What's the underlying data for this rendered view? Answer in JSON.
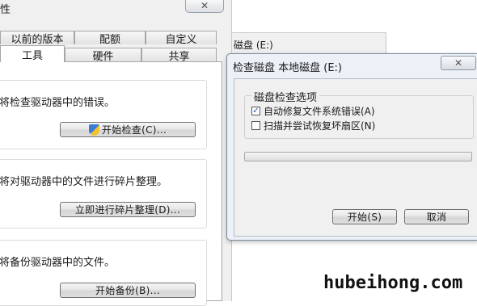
{
  "properties_dialog": {
    "title_fragment": "性",
    "close_glyph": "✕",
    "tabs_back_row": [
      "以前的版本",
      "配额",
      "自定义"
    ],
    "tabs_front_row": [
      "工具",
      "硬件",
      "共享"
    ],
    "error_check": {
      "description": "将检查驱动器中的错误。",
      "button_label": "开始检查(C)..."
    },
    "defrag": {
      "description": "将对驱动器中的文件进行碎片整理。",
      "button_label": "立即进行碎片整理(D)..."
    },
    "backup": {
      "description": "将备份驱动器中的文件。",
      "button_label": "开始备份(B)..."
    }
  },
  "background_window": {
    "drive_label": "磁盘 (E:)"
  },
  "check_disk_dialog": {
    "title": "检查磁盘 本地磁盘 (E:)",
    "close_glyph": "✕",
    "options_group_label": "磁盘检查选项",
    "options": [
      {
        "label": "自动修复文件系统错误(A)",
        "checked": true
      },
      {
        "label": "扫描并尝试恢复坏扇区(N)",
        "checked": false
      }
    ],
    "progress": 0,
    "start_button": "开始(S)",
    "cancel_button": "取消"
  },
  "watermark": "hubeihong.com",
  "colors": {
    "dialog_background": "#f0f0f0",
    "check_dialog_frame": "#ecf1f7",
    "checkbox_mark": "#2050a0"
  },
  "icons": {
    "error_check_button": "uac-shield-icon"
  }
}
